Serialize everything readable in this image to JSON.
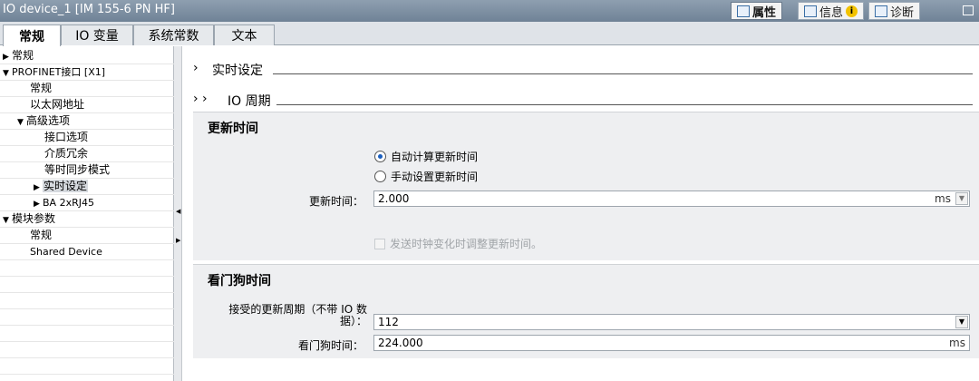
{
  "window": {
    "title": "IO device_1 [IM 155-6 PN HF]",
    "buttons": [
      {
        "label": "属性",
        "icon": "properties-icon",
        "active": true
      },
      {
        "label": "信息",
        "icon": "info-icon",
        "active": false
      },
      {
        "label": "诊断",
        "icon": "diagnostics-icon",
        "active": false
      }
    ],
    "info_badge": "i"
  },
  "tabs": [
    "常规",
    "IO 变量",
    "系统常数",
    "文本"
  ],
  "tree": [
    {
      "label": "常规",
      "arrow": "▶",
      "indent": 0
    },
    {
      "label": "PROFINET接口 [X1]",
      "arrow": "▼",
      "indent": 0
    },
    {
      "label": "常规",
      "arrow": "",
      "indent": 1
    },
    {
      "label": "以太网地址",
      "arrow": "",
      "indent": 1
    },
    {
      "label": "高级选项",
      "arrow": "▼",
      "indent": 1
    },
    {
      "label": "接口选项",
      "arrow": "",
      "indent": 2
    },
    {
      "label": "介质冗余",
      "arrow": "",
      "indent": 2
    },
    {
      "label": "等时同步模式",
      "arrow": "",
      "indent": 2
    },
    {
      "label": "实时设定",
      "arrow": "▶",
      "indent": 2,
      "selected": true
    },
    {
      "label": "BA 2xRJ45",
      "arrow": "▶",
      "indent": 2
    },
    {
      "label": "模块参数",
      "arrow": "▼",
      "indent": 0
    },
    {
      "label": "常规",
      "arrow": "",
      "indent": 1
    },
    {
      "label": "Shared Device",
      "arrow": "",
      "indent": 1
    }
  ],
  "content": {
    "section_realtime": {
      "chevron": "›",
      "label": "实时设定"
    },
    "section_io_cycle": {
      "chevron": "› ›",
      "label": "IO 周期"
    },
    "update_time": {
      "title": "更新时间",
      "radio_auto": "自动计算更新时间",
      "radio_manual": "手动设置更新时间",
      "selected": "auto",
      "field_label": "更新时间：",
      "field_value": "2.000",
      "field_unit": "ms",
      "checkbox_label": "发送时钟变化时调整更新时间。"
    },
    "watchdog": {
      "title": "看门狗时间",
      "cycles_label_line1": "接受的更新周期（不带 IO 数",
      "cycles_label_line2": "据）：",
      "cycles_value": "112",
      "time_label": "看门狗时间：",
      "time_value": "224.000",
      "time_unit": "ms"
    }
  },
  "colors": {
    "titlebar": "#7a8ca0",
    "group_bg": "#eeeff1",
    "radio_selected": "#1b5fbf"
  }
}
